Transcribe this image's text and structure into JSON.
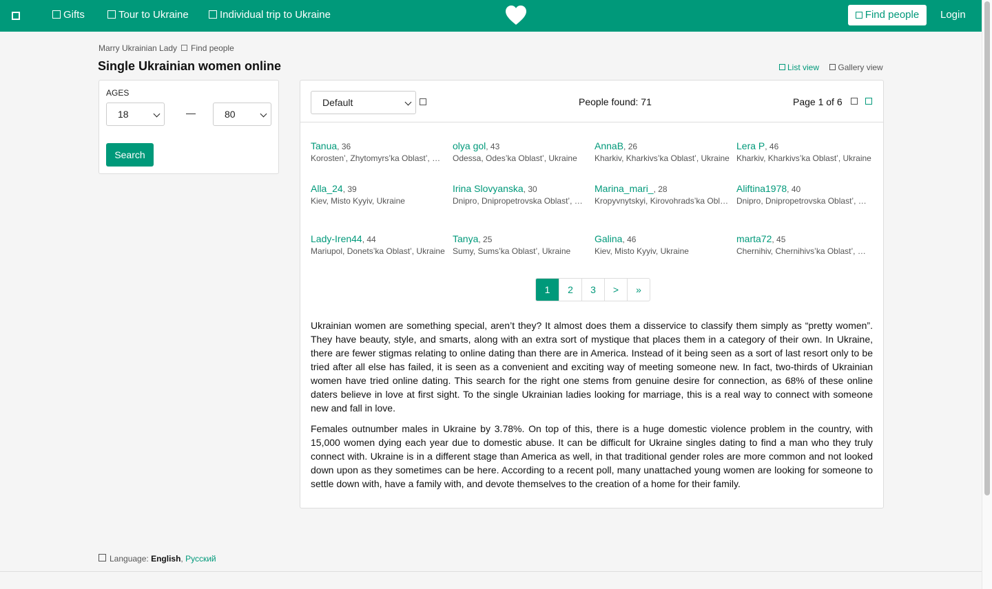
{
  "nav": {
    "gifts": "Gifts",
    "tour": "Tour to Ukraine",
    "individual_trip": "Individual trip to Ukraine",
    "find_people": "Find people",
    "login": "Login"
  },
  "breadcrumb": {
    "home": "Marry Ukrainian Lady",
    "current": "Find people"
  },
  "page_title": "Single Ukrainian women online",
  "view": {
    "list": "List view",
    "gallery": "Gallery view"
  },
  "filter": {
    "ages_label": "AGES",
    "age_min": "18",
    "age_separator": "—",
    "age_max": "80",
    "search_label": "Search"
  },
  "results": {
    "sort_value": "Default",
    "people_found": "People found: 71",
    "page_of": "Page 1 of 6"
  },
  "people": [
    {
      "name": "Tanua",
      "age": ", 36",
      "location": "Korosten’, Zhytomyrs’ka Oblast’, Ukraine"
    },
    {
      "name": "olya gol",
      "age": ", 43",
      "location": "Odessa, Odes’ka Oblast’, Ukraine"
    },
    {
      "name": "AnnaB",
      "age": ", 26",
      "location": "Kharkiv, Kharkivs’ka Oblast’, Ukraine"
    },
    {
      "name": "Lera P",
      "age": ", 46",
      "location": "Kharkiv, Kharkivs’ka Oblast’, Ukraine"
    },
    {
      "name": "Alla_24",
      "age": ", 39",
      "location": "Kiev, Misto Kyyiv, Ukraine"
    },
    {
      "name": "Irina Slovyanska",
      "age": ", 30",
      "location": "Dnipro, Dnipropetrovska Oblast’, Ukraine"
    },
    {
      "name": "Marina_mari_",
      "age": ", 28",
      "location": "Kropyvnytskyi, Kirovohrads’ka Oblast’, Ukraine"
    },
    {
      "name": "Aliftina1978",
      "age": ", 40",
      "location": "Dnipro, Dnipropetrovska Oblast’, Ukraine"
    },
    {
      "name": "Lady-Iren44",
      "age": ", 44",
      "location": "Mariupol, Donets’ka Oblast’, Ukraine"
    },
    {
      "name": "Tanya",
      "age": ", 25",
      "location": "Sumy, Sums’ka Oblast’, Ukraine"
    },
    {
      "name": "Galina",
      "age": ", 46",
      "location": "Kiev, Misto Kyyiv, Ukraine"
    },
    {
      "name": "marta72",
      "age": ", 45",
      "location": "Chernihiv, Chernihivs’ka Oblast’, Ukraine"
    }
  ],
  "pagination": {
    "p1": "1",
    "p2": "2",
    "p3": "3",
    "next": ">",
    "last": "»"
  },
  "article": {
    "p1": "Ukrainian women are something special, aren’t they? It almost does them a disservice to classify them simply as “pretty women”. They have beauty, style, and smarts, along with an extra sort of mystique that places them in a category of their own. In Ukraine, there are fewer stigmas relating to online dating than there are in America. Instead of it being seen as a sort of last resort only to be tried after all else has failed, it is seen as a convenient and exciting way of meeting someone new. In fact, two-thirds of Ukrainian women have tried online dating. This search for the right one stems from genuine desire for connection, as 68% of these online daters believe in love at first sight. To the single Ukrainian ladies looking for marriage, this is a real way to connect with someone new and fall in love.",
    "p2": "Females outnumber males in Ukraine by 3.78%. On top of this, there is a huge domestic violence problem in the country, with 15,000 women dying each year due to domestic abuse. It can be difficult for Ukraine singles dating to find a man who they truly connect with. Ukraine is in a different stage than America as well, in that traditional gender roles are more common and not looked down upon as they sometimes can be here. According to a recent poll, many unattached young women are looking for someone to settle down with, have a family with, and devote themselves to the creation of a home for their family."
  },
  "footer": {
    "language_label": "Language:",
    "english": "English",
    "russian": "Русский"
  },
  "colors": {
    "brand": "#00997a"
  }
}
